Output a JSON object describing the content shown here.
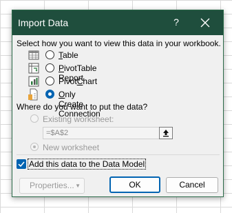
{
  "dialog": {
    "title": "Import Data",
    "help_label": "?",
    "prompt": "Select how you want to view this data in your workbook.",
    "view_options": [
      {
        "label": "Table",
        "underline": "T",
        "rest": "able",
        "icon": "table-icon",
        "selected": false
      },
      {
        "label": "PivotTable Report",
        "underline": "P",
        "rest": "ivotTable Report",
        "icon": "pivottable-icon",
        "selected": false
      },
      {
        "label": "PivotChart",
        "pre": "Pivot",
        "underline": "C",
        "rest": "hart",
        "icon": "pivotchart-icon",
        "selected": false
      },
      {
        "label": "Only Create Connection",
        "underline": "O",
        "rest": "nly Create Connection",
        "icon": "connection-icon",
        "selected": true
      }
    ],
    "where_prompt": "Where do you want to put the data?",
    "existing_worksheet": "Existing worksheet:",
    "cell_reference": "=$A$2",
    "new_worksheet": "New worksheet",
    "data_model_checkbox": {
      "label": "Add this data to the Data Model",
      "checked": true
    },
    "buttons": {
      "properties": "Properties...",
      "ok": "OK",
      "cancel": "Cancel"
    }
  },
  "colors": {
    "titlebar": "#1f4e3d",
    "accent": "#0063b1"
  }
}
